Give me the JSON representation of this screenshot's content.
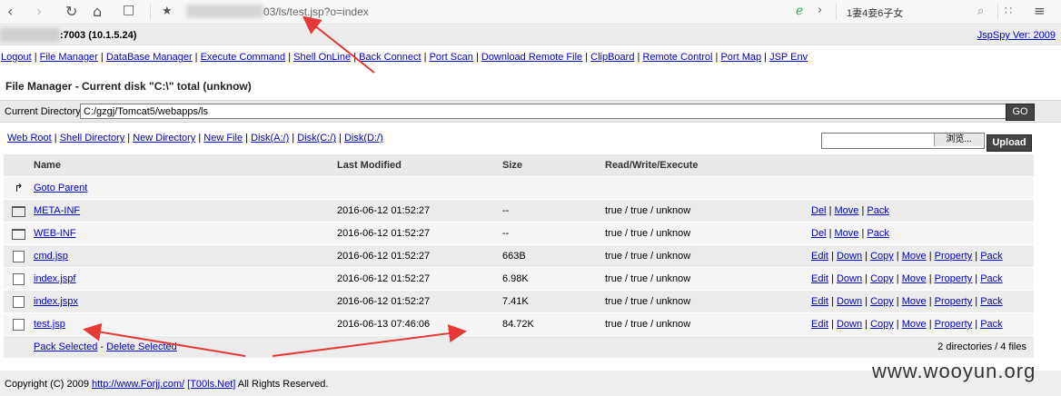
{
  "browser": {
    "url_suffix": "03/ls/test.jsp?o=index",
    "search_text": "1妻4妾6子女"
  },
  "header": {
    "host": ":7003 (10.1.5.24)",
    "version": "JspSpy Ver: 2009"
  },
  "nav": [
    "Logout",
    "File Manager",
    "DataBase Manager",
    "Execute Command",
    "Shell OnLine",
    "Back Connect",
    "Port Scan",
    "Download Remote File",
    "ClipBoard",
    "Remote Control",
    "Port Map",
    "JSP Env"
  ],
  "title": "File Manager - Current disk \"C:\\\" total (unknow)",
  "current_dir": {
    "label": "Current Directory",
    "value": "C:/gzgj/Tomcat5/webapps/ls",
    "go": "GO"
  },
  "quick_links": [
    "Web Root",
    "Shell Directory",
    "New Directory",
    "New File",
    "Disk(A:/)",
    "Disk(C:/)",
    "Disk(D:/)"
  ],
  "upload": {
    "browse": "浏览...",
    "button": "Upload"
  },
  "columns": [
    "Name",
    "Last Modified",
    "Size",
    "Read/Write/Execute"
  ],
  "goto_parent": "Goto Parent",
  "rows": [
    {
      "type": "dir",
      "name": "META-INF",
      "modified": "2016-06-12 01:52:27",
      "size": "--",
      "rwx": "true / true / unknow",
      "actions": [
        "Del",
        "Move",
        "Pack"
      ]
    },
    {
      "type": "dir",
      "name": "WEB-INF",
      "modified": "2016-06-12 01:52:27",
      "size": "--",
      "rwx": "true / true / unknow",
      "actions": [
        "Del",
        "Move",
        "Pack"
      ]
    },
    {
      "type": "file",
      "name": "cmd.jsp",
      "modified": "2016-06-12 01:52:27",
      "size": "663B",
      "rwx": "true / true / unknow",
      "actions": [
        "Edit",
        "Down",
        "Copy",
        "Move",
        "Property",
        "Pack"
      ]
    },
    {
      "type": "file",
      "name": "index.jspf",
      "modified": "2016-06-12 01:52:27",
      "size": "6.98K",
      "rwx": "true / true / unknow",
      "actions": [
        "Edit",
        "Down",
        "Copy",
        "Move",
        "Property",
        "Pack"
      ]
    },
    {
      "type": "file",
      "name": "index.jspx",
      "modified": "2016-06-12 01:52:27",
      "size": "7.41K",
      "rwx": "true / true / unknow",
      "actions": [
        "Edit",
        "Down",
        "Copy",
        "Move",
        "Property",
        "Pack"
      ]
    },
    {
      "type": "file",
      "name": "test.jsp",
      "modified": "2016-06-13 07:46:06",
      "size": "84.72K",
      "rwx": "true / true / unknow",
      "actions": [
        "Edit",
        "Down",
        "Copy",
        "Move",
        "Property",
        "Pack"
      ]
    }
  ],
  "footer_links": [
    "Pack Selected",
    "Delete Selected"
  ],
  "summary": "2 directories / 4 files",
  "copyright": {
    "prefix": "Copyright (C) 2009",
    "link1": "http://www.Forjj.com/",
    "link2": "[T00ls.Net]",
    "suffix": "All Rights Reserved."
  },
  "watermark": "www.wooyun.org",
  "colors": {
    "arrow": "#e53935",
    "link": "#0000cc",
    "dark_button": "#444444"
  }
}
